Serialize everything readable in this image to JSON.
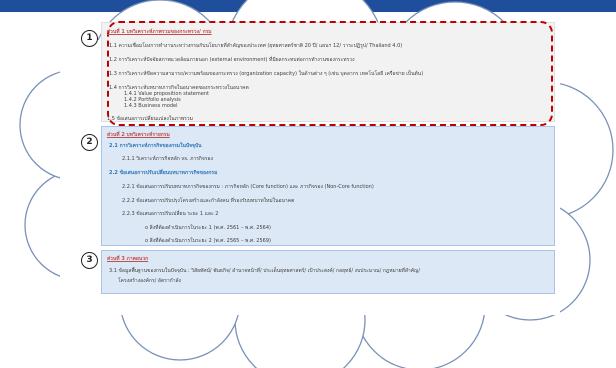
{
  "markers": [
    "1",
    "2",
    "3"
  ],
  "section1": {
    "heading": "ส่วนที่ 1 บทวิเคราะห์ภาพรวมของกระทรวง/ กรม",
    "items": [
      "1.1  ความเชื่อมโยงการทำงานระหว่างกรมกับนโยบายที่สำคัญของประเทศ (ยุทธศาสตร์ชาติ 20 ปี/ แผนฯ 12/ วาระปฏิรูป/ Thailand 4.0)",
      "1.2  การวิเคราะห์ปัจจัยสภาพแวดล้อมภายนอก (external environment) ที่มีผลกระทบต่อการทำงานของกระทรวง",
      "1.3  การวิเคราะห์ขีดความสามารถ/ความพร้อมของกระทรวง (organization capacity) ในด้านต่าง ๆ (เช่น บุคลากร เทคโนโลยี เครือข่าย เป็นต้น)",
      "1.4  การวิเคราะห์บทบาทภารกิจในอนาคตของกระทรวงในอนาคต"
    ],
    "subitems": [
      "1.4.1 Value proposition statement",
      "1.4.2 Portfolio analysis",
      "1.4.3 Business model"
    ],
    "last_item": "1.5 ข้อเสนอการเปลี่ยนแปลงในภาพรวม"
  },
  "section2": {
    "heading": "ส่วนที่ 2 บทวิเคราะห์รายกรม",
    "sub1": "2.1  การวิเคราะห์ภารกิจของกรมในปัจจุบัน",
    "sub1_item": "2.1.1 วิเคราะห์ภารกิจหลัก vs. ภารกิจรอง",
    "sub2": "2.2  ข้อเสนอการปรับเปลี่ยนบทบาทภารกิจของกรม",
    "sub2_items": [
      "2.2.1 ข้อเสนอการปรับบทบาทภารกิจของกรม : ภารกิจหลัก (Core function) และ ภารกิจรอง (Non-Core function)",
      "2.2.2 ข้อเสนอการปรับปรุงโครงสร้างและกำลังคน ที่รองรับบทบาทใหม่ในอนาคต",
      "2.2.3 ข้อเสนอการปรับเปลี่ยน ระยะ 1 และ 2"
    ],
    "bullets": [
      "o  สิ่งที่ต้องดำเนินการในระยะ 1 (พ.ศ. 2561 – พ.ศ. 2564)",
      "o  สิ่งที่ต้องดำเนินการในระยะ 2 (พ.ศ. 2565 – พ.ศ. 2569)"
    ]
  },
  "section3": {
    "heading": "ส่วนที่ 3 ภาคผนวก",
    "item_line1": "3.1  ข้อมูลพื้นฐานของกรมในปัจจุบัน : วิสัยทัศน์/ พันธกิจ/ อำนาจหน้าที่/ ประเด็นยุทธศาสตร์/ เป้าประสงค์/ กลยุทธ์/ งบประมาณ/ กฎหมายที่สำคัญ/",
    "item_line2": "โครงสร้างองค์กร/ อัตรากำลัง"
  }
}
